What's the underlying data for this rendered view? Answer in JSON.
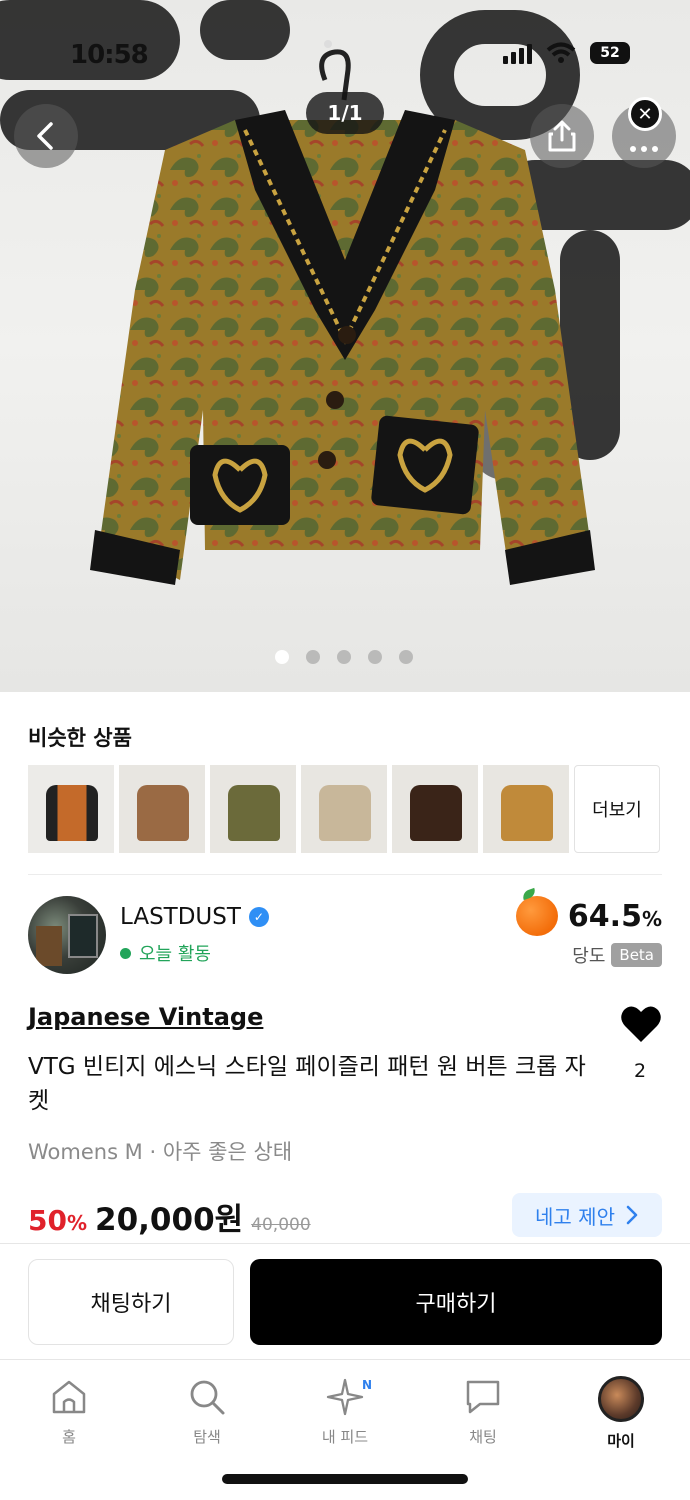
{
  "status_bar": {
    "time": "10:58"
  },
  "hero": {
    "counter": "1/1",
    "back_icon": "chevron-left-icon",
    "share_icon": "share-icon",
    "more_icon": "more-icon",
    "close_icon": "close-icon",
    "close_glyph": "✕"
  },
  "similar": {
    "title": "비슷한 상품",
    "more_label": "더보기"
  },
  "seller": {
    "name": "LASTDUST",
    "activity": "오늘 활동",
    "score_value": "64.5",
    "score_unit": "%",
    "score_label": "당도",
    "beta_label": "Beta"
  },
  "product": {
    "brand": "Japanese Vintage",
    "title": "VTG 빈티지 에스닉 스타일 페이즐리 패턴 원 버튼 크롭 자켓",
    "meta": "Womens M · 아주 좋은 상태",
    "likes": "2",
    "discount": "50",
    "discount_unit": "%",
    "price": "20,000원",
    "original_price": "40,000",
    "nego_label": "네고 제안"
  },
  "actions": {
    "chat_label": "채팅하기",
    "buy_label": "구매하기"
  },
  "tabbar": {
    "tabs": [
      {
        "label": "홈"
      },
      {
        "label": "탐색"
      },
      {
        "label": "내 피드"
      },
      {
        "label": "채팅"
      },
      {
        "label": "마이"
      }
    ],
    "feed_badge": "N"
  },
  "colors": {
    "accent_red": "#e0222b",
    "accent_blue": "#2f80ed",
    "activity_green": "#22a45a"
  }
}
